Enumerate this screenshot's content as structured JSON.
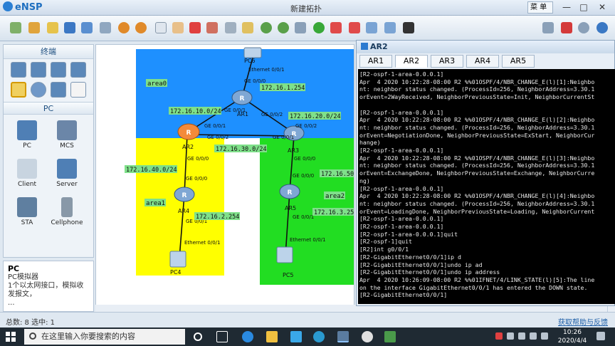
{
  "app": {
    "name": "eNSP",
    "window_title": "新建拓扑",
    "menu_label": "菜 单"
  },
  "window_controls": {
    "minimize": "—",
    "maximize": "□",
    "close": "✕"
  },
  "palette": {
    "header": "终端",
    "sub_header": "PC",
    "devices": [
      {
        "label": "PC",
        "icon": "pc-icon"
      },
      {
        "label": "MCS",
        "icon": "mcs-icon"
      },
      {
        "label": "Client",
        "icon": "client-icon"
      },
      {
        "label": "Server",
        "icon": "server-icon"
      },
      {
        "label": "STA",
        "icon": "sta-icon"
      },
      {
        "label": "Cellphone",
        "icon": "cellphone-icon"
      }
    ],
    "desc_title": "PC",
    "desc_line1": "PC模拟器",
    "desc_line2": "1个以太网接口，模拟收",
    "desc_line3": "发报文，",
    "desc_line4": "..."
  },
  "topology": {
    "areas": {
      "area0": "area0",
      "area1": "area1",
      "area2": "area2"
    },
    "nodes": {
      "pc6": "PC6",
      "ar1": "AR1",
      "ar2": "AR2",
      "ar3": "AR3",
      "ar4": "AR4",
      "ar5": "AR5",
      "pc4": "PC4",
      "pc5": "PC5"
    },
    "ports": {
      "pc6_eth": "Ethernet 0/0/1",
      "ar1_up": "GE 0/0/0",
      "ar1_left": "GE 0/0/1",
      "ar1_right": "GE 0/0/2",
      "ar2_top": "GE 0/0/1",
      "ar2_right": "GE 0/0/2",
      "ar2_down": "GE 0/0/0",
      "ar3_top": "GE 0/0/2",
      "ar3_left": "GE 0/0/1",
      "ar3_down": "GE 0/0/0",
      "ar4_top": "GE 0/0/0",
      "ar4_down": "GE 0/0/1",
      "ar5_top": "GE 0/0/0",
      "ar5_down": "GE 0/0/1",
      "pc4_eth": "Ethernet 0/0/1",
      "pc5_eth": "Ethernet 0/0/1"
    },
    "subnets": {
      "n161": "172.16.1.254",
      "n1610": "172.16.10.0/24",
      "n1620": "172.16.20.0/24",
      "n1630": "172.16.30.0/24",
      "n1640": "172.16.40.0/24",
      "n1650": "172.16.50",
      "n162": "172.16.2.254",
      "n163": "172.16.3.25"
    }
  },
  "console": {
    "title": "AR2",
    "tabs": [
      "AR1",
      "AR2",
      "AR3",
      "AR4",
      "AR5"
    ],
    "active_tab": "AR2",
    "lines": [
      "[R2-ospf-1-area-0.0.0.1]",
      "Apr  4 2020 10:22:28-08:00 R2 %%01OSPF/4/NBR_CHANGE_E(l)[1]:Neighbo",
      "nt: neighbor status changed. (ProcessId=256, NeighborAddress=3.30.1",
      "orEvent=2WayReceived, NeighborPreviousState=Init, NeighborCurrentSt",
      "",
      "[R2-ospf-1-area-0.0.0.1]",
      "Apr  4 2020 10:22:28-08:00 R2 %%01OSPF/4/NBR_CHANGE_E(l)[2]:Neighbo",
      "nt: neighbor status changed. (ProcessId=256, NeighborAddress=3.30.1",
      "orEvent=NegotiationDone, NeighborPreviousState=ExStart, NeighborCur",
      "hange)",
      "[R2-ospf-1-area-0.0.0.1]",
      "Apr  4 2020 10:22:28-08:00 R2 %%01OSPF/4/NBR_CHANGE_E(l)[3]:Neighbo",
      "nt: neighbor status changed. (ProcessId=256, NeighborAddress=3.30.1",
      "orEvent=ExchangeDone, NeighborPreviousState=Exchange, NeighborCurre",
      "ng)",
      "[R2-ospf-1-area-0.0.0.1]",
      "Apr  4 2020 10:22:28-08:00 R2 %%01OSPF/4/NBR_CHANGE_E(l)[4]:Neighbo",
      "nt: neighbor status changed. (ProcessId=256, NeighborAddress=3.30.1",
      "orEvent=LoadingDone, NeighborPreviousState=Loading, NeighborCurrent",
      "[R2-ospf-1-area-0.0.0.1]",
      "[R2-ospf-1-area-0.0.0.1]",
      "[R2-ospf-1-area-0.0.0.1]quit",
      "[R2-ospf-1]quit",
      "[R2]int g0/0/1",
      "[R2-GigabitEthernet0/0/1]ip d",
      "[R2-GigabitEthernet0/0/1]undo ip ad",
      "[R2-GigabitEthernet0/0/1]undo ip address",
      "Apr  4 2020 10:26:09-08:00 R2 %%01IFNET/4/LINK_STATE(l)[5]:The line",
      "on the interface GigabitEthernet0/0/1 has entered the DOWN state.",
      "[R2-GigabitEthernet0/0/1]"
    ]
  },
  "status": {
    "left": "总数: 8 选中: 1",
    "right": "获取帮助与反馈"
  },
  "taskbar": {
    "search_placeholder": "在这里输入你要搜索的内容",
    "time": "10:26",
    "date": "2020/4/4"
  },
  "colors": {
    "area0": "#1e90ff",
    "area1": "#ffff00",
    "area2": "#22dd22",
    "label_bg": "#7fe08a"
  }
}
